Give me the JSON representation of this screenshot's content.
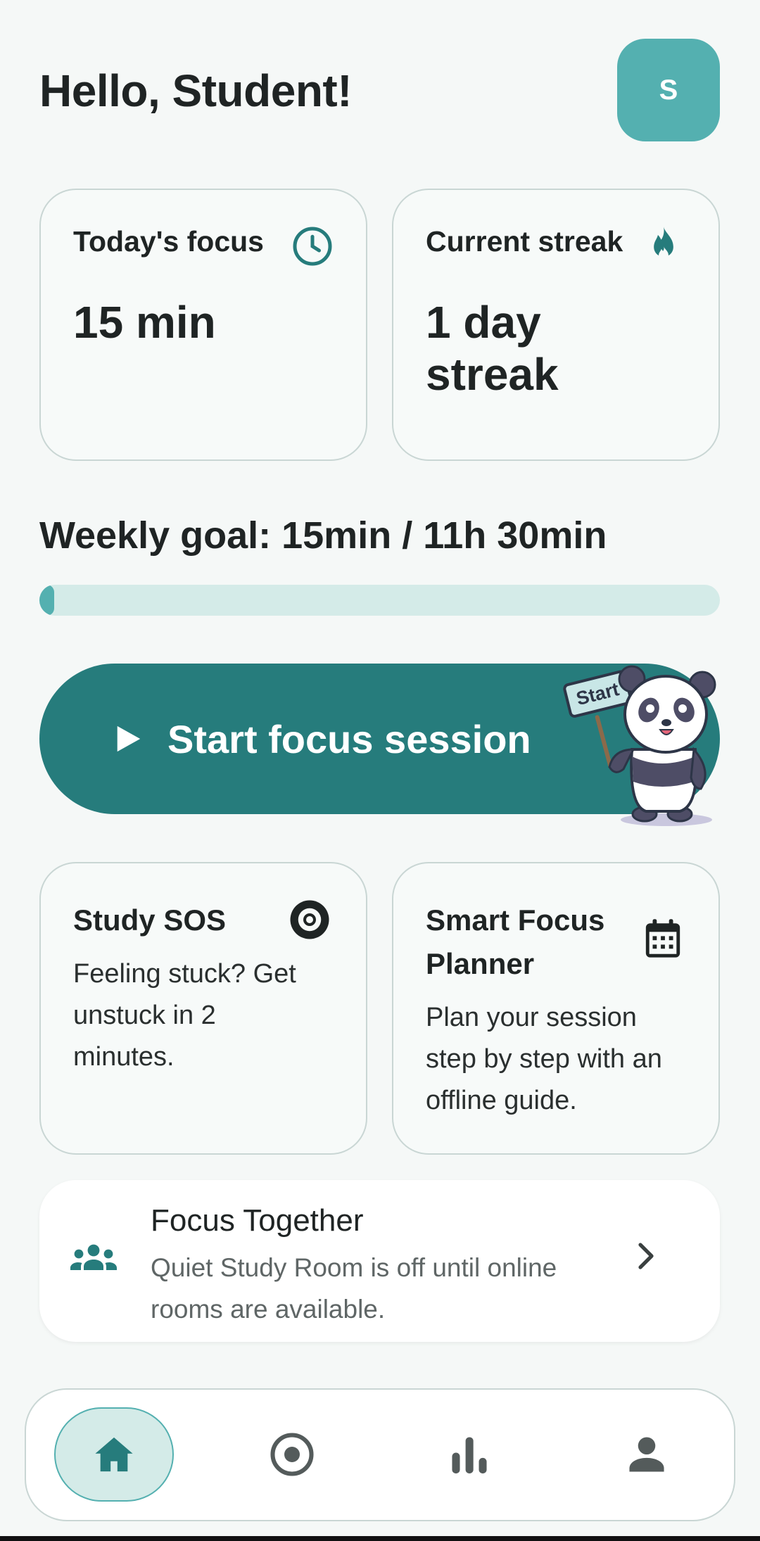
{
  "header": {
    "greeting": "Hello, Student!",
    "avatar_initial": "S"
  },
  "stats": {
    "focus": {
      "title": "Today's focus",
      "value": "15 min",
      "icon": "clock-icon"
    },
    "streak": {
      "title": "Current streak",
      "value": "1 day streak",
      "icon": "flame-icon"
    }
  },
  "weekly_goal": {
    "label": "Weekly goal: 15min / 11h 30min",
    "progress_fraction": 0.022
  },
  "start": {
    "label": "Start focus session",
    "mascot_sign": "Start"
  },
  "features": {
    "sos": {
      "title": "Study SOS",
      "desc": "Feeling stuck? Get unstuck in 2 minutes.",
      "icon": "lifebuoy-icon"
    },
    "planner": {
      "title": "Smart Focus Planner",
      "desc": "Plan your session step by step with an offline guide.",
      "icon": "calendar-icon"
    }
  },
  "together": {
    "title": "Focus Together",
    "subtitle": "Quiet Study Room is off until online rooms are available.",
    "icon": "group-icon"
  },
  "nav": {
    "active": "home",
    "items": [
      "home-icon",
      "focus-icon",
      "stats-icon",
      "profile-icon"
    ]
  },
  "colors": {
    "primary": "#267c7c",
    "accent": "#54b0b0",
    "track": "#d4ebe8",
    "background": "#f5f8f7"
  }
}
